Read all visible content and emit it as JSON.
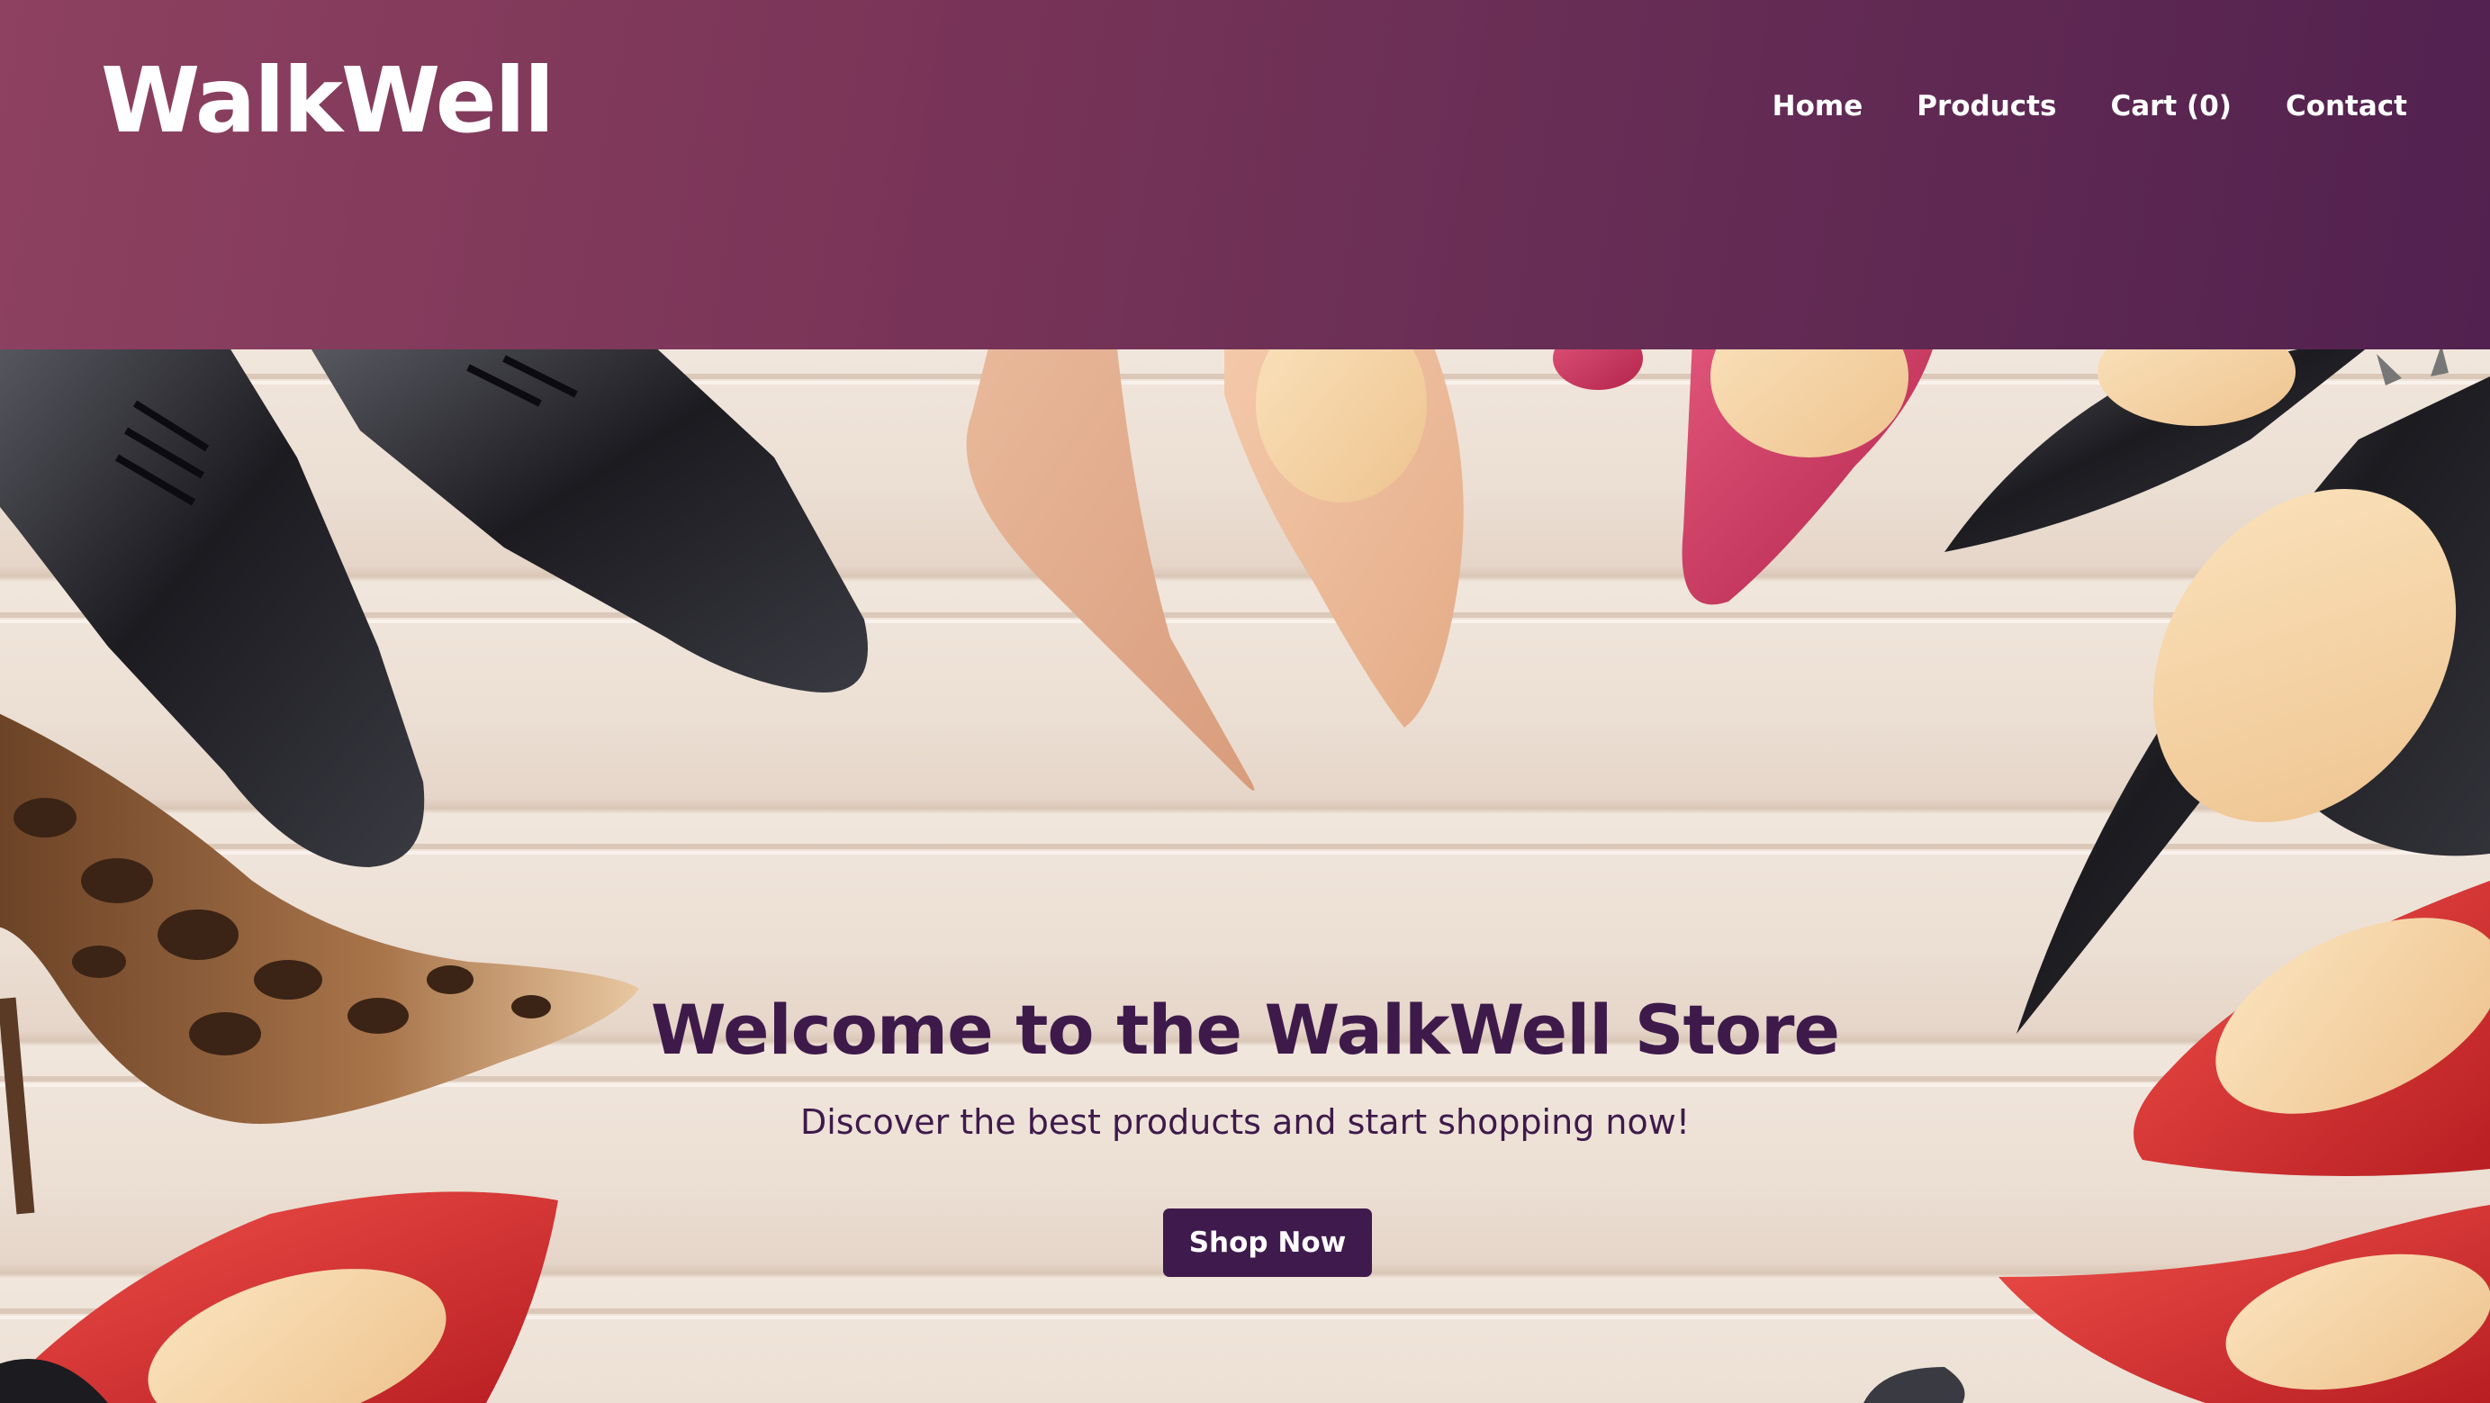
{
  "header": {
    "logo": "WalkWell",
    "nav": {
      "home": "Home",
      "products": "Products",
      "cart": "Cart (0)",
      "contact": "Contact"
    }
  },
  "hero": {
    "title": "Welcome to the WalkWell Store",
    "subtitle": "Discover the best products and start shopping now!",
    "cta": "Shop Now"
  },
  "colors": {
    "header_gradient_start": "#8e4160",
    "header_gradient_end": "#52214f",
    "heading_text": "#3e1a4b",
    "button_bg": "#3f1a4d",
    "floor": "#efe3d8"
  },
  "hero_image": {
    "shoes": [
      "black-oxford-left",
      "black-oxford-right",
      "nude-pump",
      "beige-pump",
      "pink-pump",
      "black-stiletto",
      "black-studded-pump",
      "leopard-pump",
      "red-pump-left",
      "red-pump-right",
      "red-pump-bottom-right"
    ]
  }
}
